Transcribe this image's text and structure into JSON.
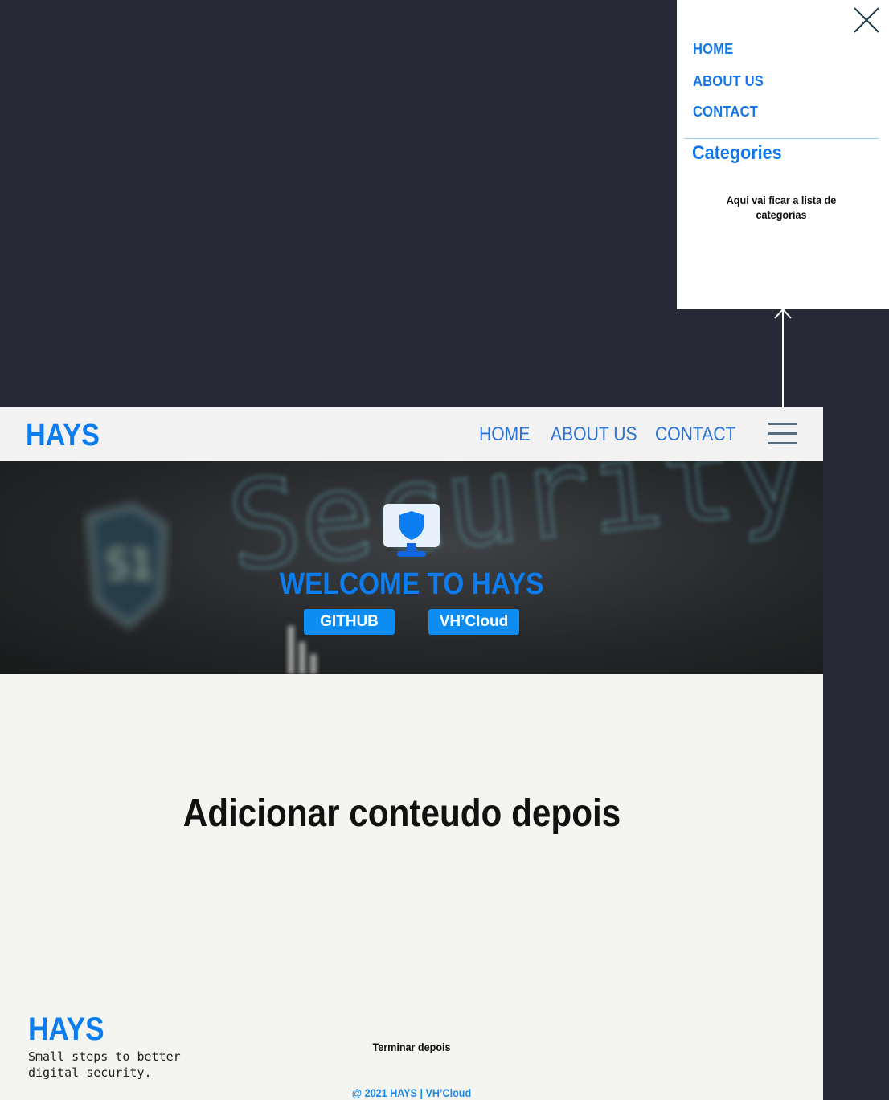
{
  "side_menu": {
    "links": [
      "HOME",
      "ABOUT US",
      "CONTACT"
    ],
    "categories_title": "Categories",
    "categories_note": "Aqui vai ficar a lista de categorias"
  },
  "navbar": {
    "logo": "HAYS",
    "links": [
      "HOME",
      "ABOUT US",
      "CONTACT"
    ],
    "menu_icon": "hamburger-icon"
  },
  "hero": {
    "background_text": "Security",
    "icon": "monitor-shield-icon",
    "title": "WELCOME TO HAYS",
    "buttons": [
      "GITHUB",
      "VH’Cloud"
    ]
  },
  "content": {
    "heading": "Adicionar conteudo depois"
  },
  "footer": {
    "logo": "HAYS",
    "tagline": "Small steps to better digital security.",
    "note": "Terminar depois",
    "copyright": "@ 2021 HAYS | VH’Cloud"
  },
  "colors": {
    "brand": "#0b7df0",
    "button": "#0d8cf2",
    "page_bg": "#272a36",
    "content_bg": "#f4f5f0"
  }
}
